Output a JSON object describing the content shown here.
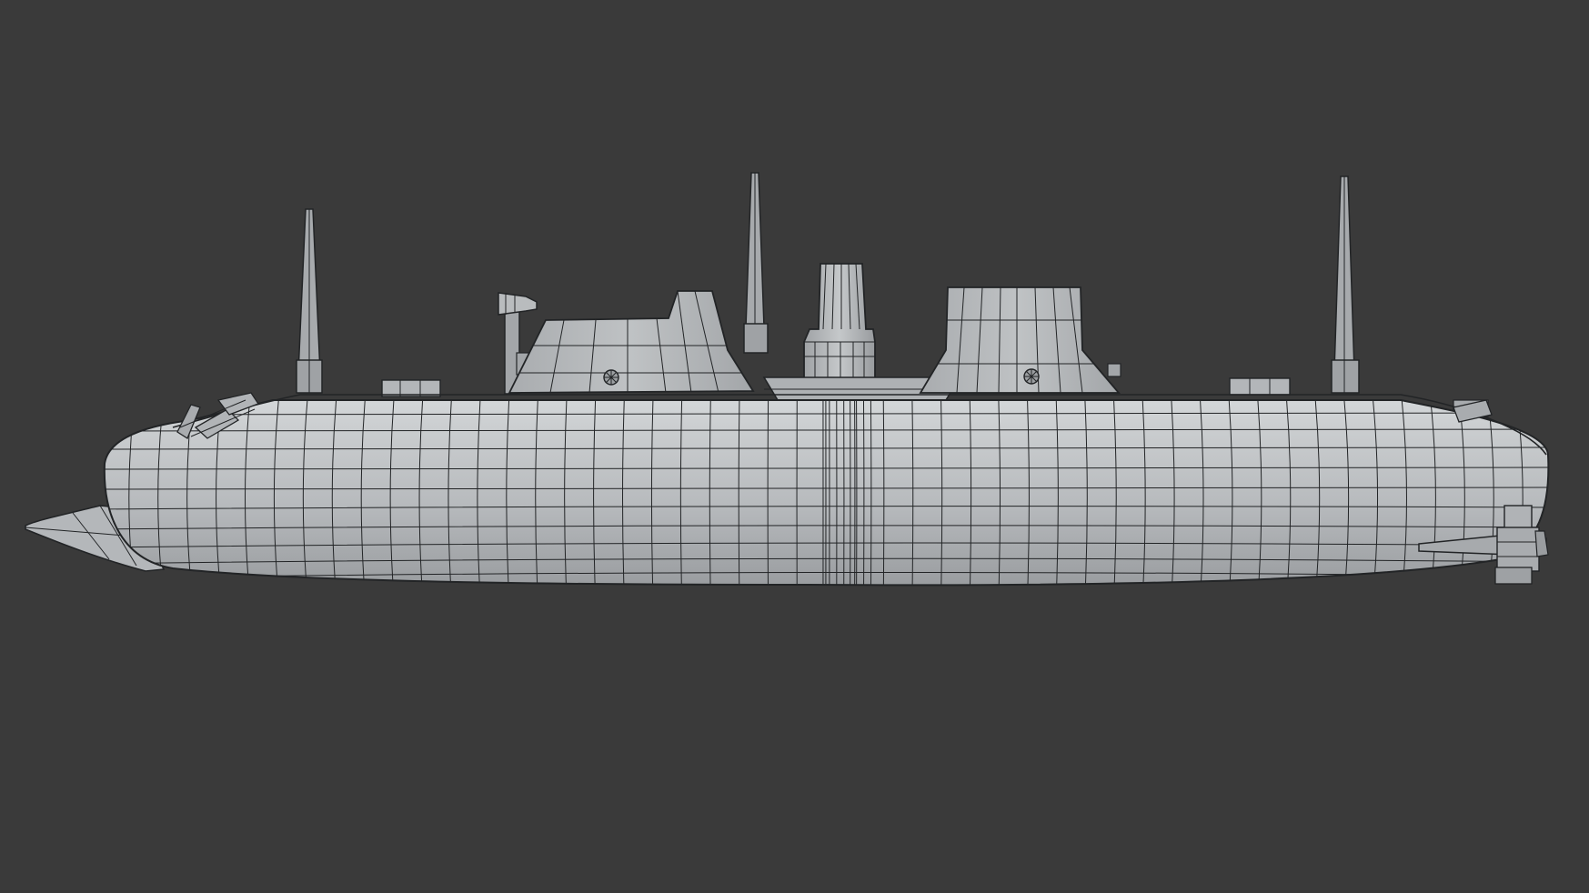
{
  "scene": {
    "subject": "ironclad-ship-wireframe-model",
    "view": "side-orthographic",
    "shading": "solid-with-wireframe",
    "colors": {
      "background": "#3a3a3a",
      "surface_light": "#c9ccce",
      "surface_mid": "#b2b5b8",
      "surface_dark": "#8e9194",
      "wire": "#222426"
    },
    "components": [
      "hull",
      "ram-bow",
      "stern-rudder",
      "forward-casemate",
      "aft-casemate",
      "smokestack",
      "mast-fore",
      "mast-main",
      "mast-aft",
      "periscope-fitting",
      "deck-hatches",
      "anchor-gear"
    ]
  }
}
